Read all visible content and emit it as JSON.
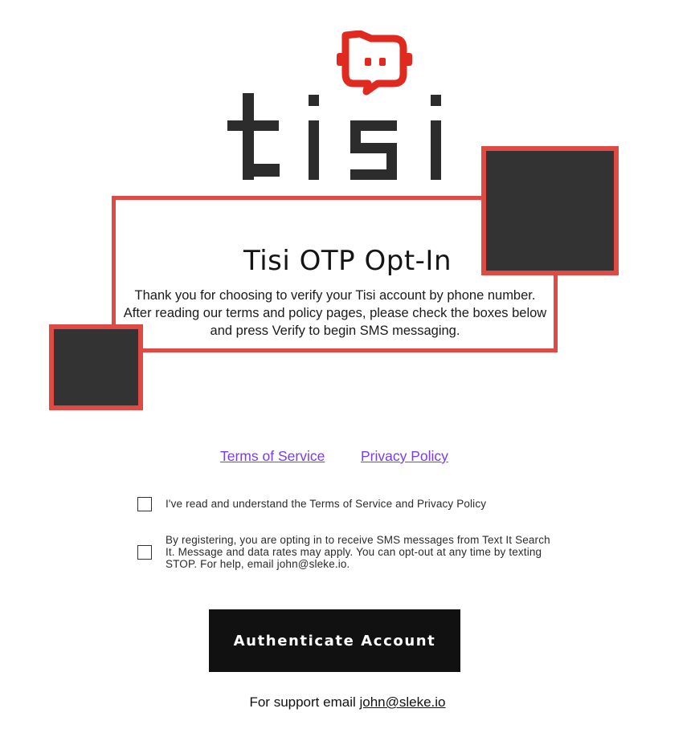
{
  "brand": {
    "logo_text": "tisi",
    "accent_color": "#e04a45",
    "dark_color": "#333333"
  },
  "card": {
    "title": "Tisi OTP Opt-In",
    "body": "Thank you for choosing to verify your Tisi account by phone number. After reading our terms and policy pages, please check the boxes below and press Verify to begin SMS messaging."
  },
  "links": {
    "terms": "Terms of Service",
    "privacy": "Privacy Policy",
    "link_color": "#7a3bf0"
  },
  "consent": {
    "read_terms": {
      "label": "I've read and understand the Terms of Service and Privacy Policy",
      "checked": false
    },
    "sms_optin": {
      "label": "By registering, you are opting in to receive SMS messages from Text It Search It. Message and data rates may apply. You can opt-out at any time by texting STOP. For help, email john@sleke.io.",
      "checked": false
    }
  },
  "actions": {
    "authenticate_label": "Authenticate Account"
  },
  "support": {
    "prefix": "For support email ",
    "email": "john@sleke.io"
  },
  "icons": {
    "logo_mark": "chat-bubble-icon"
  }
}
